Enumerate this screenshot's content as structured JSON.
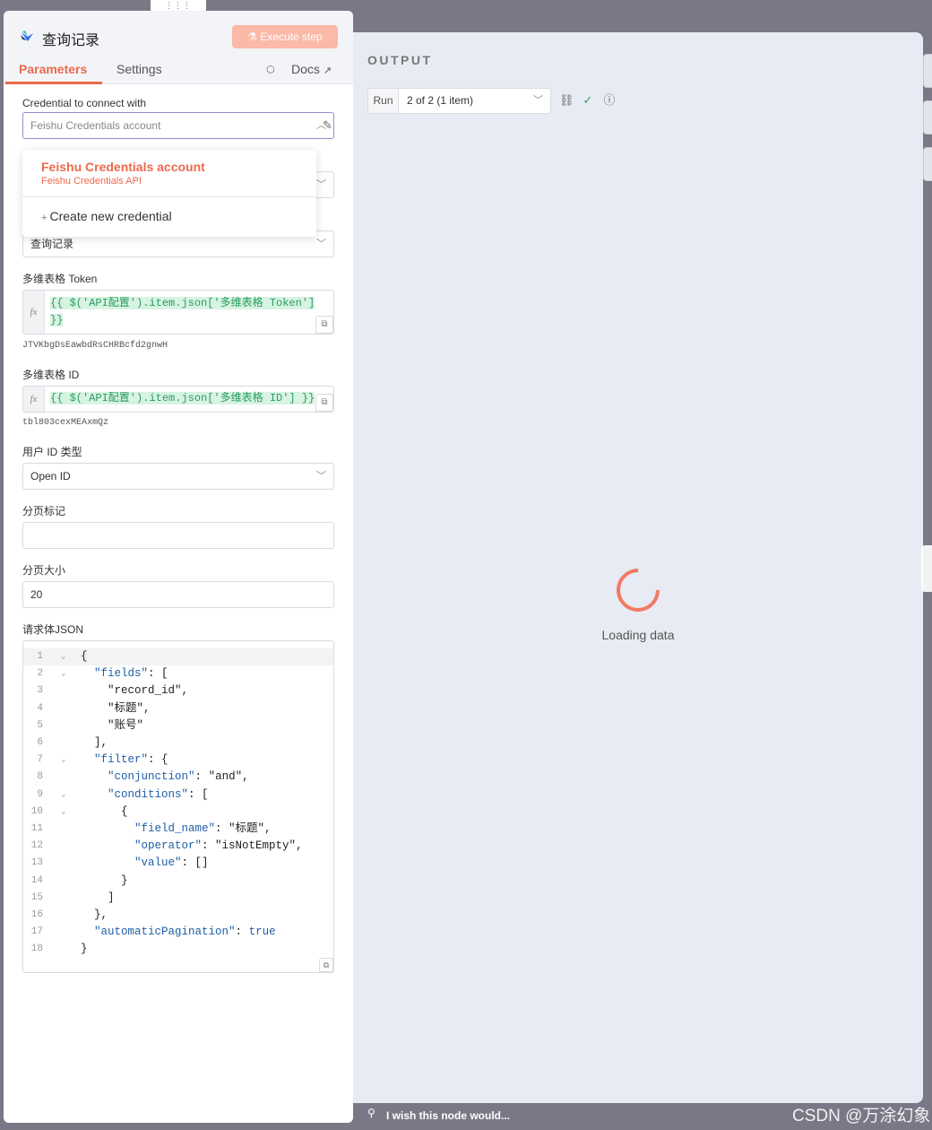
{
  "node": {
    "title": "查询记录",
    "execute_label": "Execute step"
  },
  "tabs": {
    "parameters": "Parameters",
    "settings": "Settings",
    "docs": "Docs"
  },
  "credential": {
    "label": "Credential to connect with",
    "value": "Feishu Credentials account",
    "dropdown": {
      "title": "Feishu Credentials account",
      "subtitle": "Feishu Credentials API",
      "create": "Create new credential"
    }
  },
  "operation": {
    "value": "查询记录"
  },
  "token": {
    "label": "多维表格 Token",
    "expr_line1": "{{ $('API配置').item.json['多维表格 Token'] ",
    "expr_line2": "}}",
    "resolved": "JTVKbgDsEawbdRsCHRBcfd2gnwH"
  },
  "table_id": {
    "label": "多维表格 ID",
    "expr": "{{ $('API配置').item.json['多维表格 ID'] }}",
    "resolved": "tbl803cexMEAxmQz"
  },
  "user_id_type": {
    "label": "用户 ID 类型",
    "value": "Open ID"
  },
  "page_token": {
    "label": "分页标记",
    "value": ""
  },
  "page_size": {
    "label": "分页大小",
    "value": "20"
  },
  "body_json": {
    "label": "请求体JSON",
    "lines": [
      "{",
      "  \"fields\": [",
      "    \"record_id\",",
      "    \"标题\",",
      "    \"账号\"",
      "  ],",
      "  \"filter\": {",
      "    \"conjunction\": \"and\",",
      "    \"conditions\": [",
      "      {",
      "        \"field_name\": \"标题\",",
      "        \"operator\": \"isNotEmpty\",",
      "        \"value\": []",
      "      }",
      "    ]",
      "  },",
      "  \"automaticPagination\": true",
      "}"
    ],
    "line_numbers": [
      "1",
      "2",
      "3",
      "4",
      "5",
      "6",
      "7",
      "8",
      "9",
      "10",
      "11",
      "12",
      "13",
      "14",
      "15",
      "16",
      "17",
      "18"
    ]
  },
  "output": {
    "title": "OUTPUT",
    "run_label": "Run",
    "run_value": "2 of 2 (1 item)",
    "loading": "Loading data"
  },
  "footer": {
    "feedback": "I wish this node would...",
    "watermark": "CSDN @万涂幻象"
  }
}
